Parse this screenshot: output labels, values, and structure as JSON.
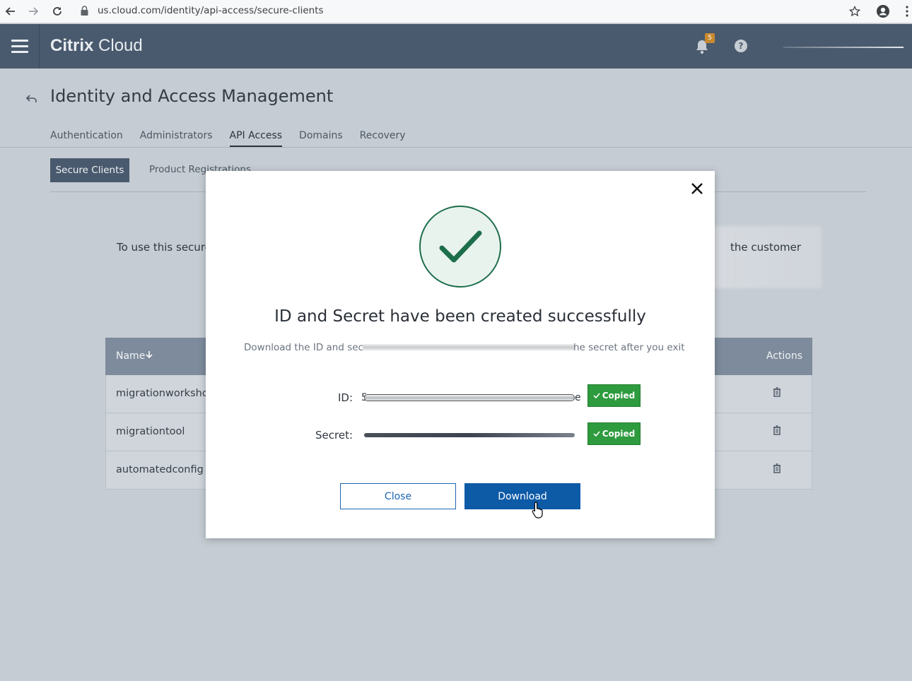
{
  "browser": {
    "url": "us.cloud.com/identity/api-access/secure-clients",
    "back_icon": "back-arrow-icon",
    "forward_icon": "forward-arrow-icon",
    "reload_icon": "reload-icon"
  },
  "header": {
    "brand_bold": "Citrix",
    "brand_light": " Cloud",
    "notification_count": "5"
  },
  "page": {
    "title": "Identity and Access Management",
    "tabs": [
      "Authentication",
      "Administrators",
      "API Access",
      "Domains",
      "Recovery"
    ],
    "active_tab": "API Access",
    "sub_tabs": [
      "Secure Clients",
      "Product Registrations"
    ],
    "intro_left": "To use this secure",
    "intro_right": "the customer"
  },
  "table": {
    "col_name": "Name",
    "col_actions": "Actions",
    "rows": [
      "migrationworkshop",
      "migrationtool",
      "automatedconfig"
    ]
  },
  "modal": {
    "title": "ID and Secret have been created successfully",
    "desc_left": "Download the ID and secre",
    "desc_right": "he secret after you exit",
    "id_label": "ID:",
    "id_start": "5",
    "id_end": "e",
    "secret_label": "Secret:",
    "copied_label": "Copied",
    "close_label": "Close",
    "download_label": "Download"
  },
  "colors": {
    "header_bg": "#4a5a6e",
    "success_green": "#2e9b3e",
    "primary_blue": "#0d5aa7"
  }
}
